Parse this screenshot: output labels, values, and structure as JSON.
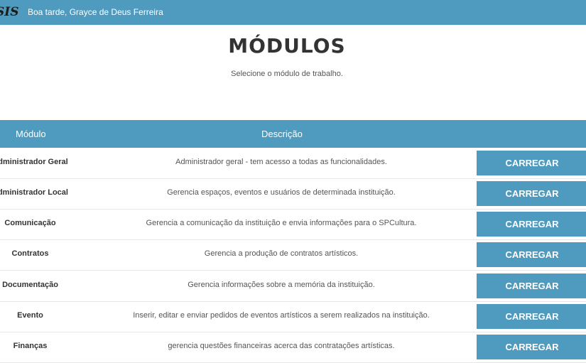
{
  "header": {
    "logo": "SIS",
    "greeting": "Boa tarde, Grayce de Deus Ferreira"
  },
  "page": {
    "title": "MÓDULOS",
    "subtitle": "Selecione o módulo de trabalho."
  },
  "table": {
    "columns": [
      "Módulo",
      "Descrição"
    ],
    "button_label": "CARREGAR",
    "rows": [
      {
        "module": "Administrador Geral",
        "description": "Administrador geral - tem acesso a todas as funcionalidades."
      },
      {
        "module": "Administrador Local",
        "description": "Gerencia espaços, eventos e usuários de determinada instituição."
      },
      {
        "module": "Comunicação",
        "description": "Gerencia a comunicação da instituição e envia informações para o SPCultura."
      },
      {
        "module": "Contratos",
        "description": "Gerencia a produção de contratos artísticos."
      },
      {
        "module": "Documentação",
        "description": "Gerencia informações sobre a memória da instituição."
      },
      {
        "module": "Evento",
        "description": "Inserir, editar e enviar pedidos de eventos artísticos a serem realizados na instituição."
      },
      {
        "module": "Finanças",
        "description": "gerencia questões financeiras acerca das contratações artísticas."
      }
    ]
  },
  "colors": {
    "accent": "#4f9bbf"
  }
}
